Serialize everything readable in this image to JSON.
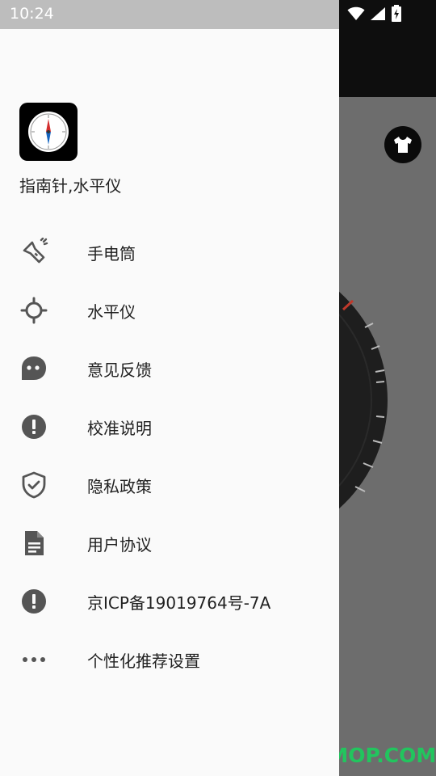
{
  "status_bar": {
    "time": "10:24"
  },
  "drawer": {
    "app_name": "指南针,水平仪",
    "items": [
      {
        "label": "手电筒",
        "icon": "flashlight-icon"
      },
      {
        "label": "水平仪",
        "icon": "crosshair-icon"
      },
      {
        "label": "意见反馈",
        "icon": "feedback-icon"
      },
      {
        "label": "校准说明",
        "icon": "info-alert-icon"
      },
      {
        "label": "隐私政策",
        "icon": "shield-check-icon"
      },
      {
        "label": "用户协议",
        "icon": "document-icon"
      },
      {
        "label": "京ICP备19019764号-7A",
        "icon": "info-alert-icon"
      },
      {
        "label": "个性化推荐设置",
        "icon": "more-horiz-icon"
      }
    ]
  },
  "watermark": "ITMOP.COM",
  "colors": {
    "drawer_bg": "#fafafa",
    "scrim": "#6d6d6d",
    "icon": "#555555",
    "watermark": "#22c55e"
  }
}
